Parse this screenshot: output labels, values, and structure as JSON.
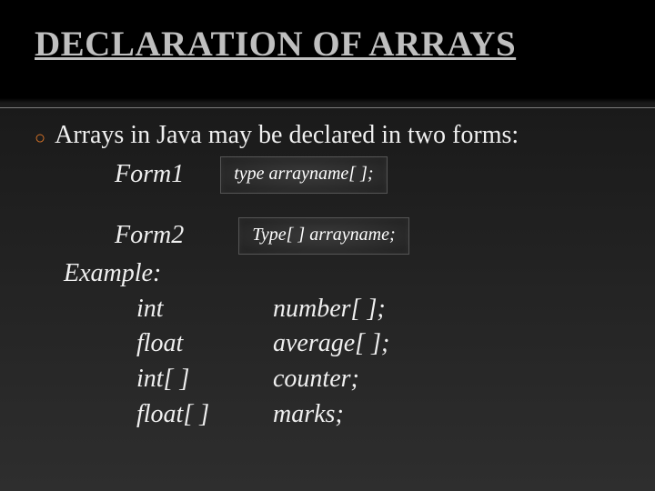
{
  "title": "DECLARATION OF ARRAYS",
  "intro": "Arrays in Java may be declared in two forms:",
  "form1": {
    "label": "Form1",
    "box": "type arrayname[ ];"
  },
  "form2": {
    "label": "Form2",
    "box": "Type[ ] arrayname;"
  },
  "exampleLabel": "Example:",
  "examples": [
    {
      "a": "int",
      "b": "number[ ];"
    },
    {
      "a": "float",
      "b": "average[ ];"
    },
    {
      "a": "int[ ]",
      "b": "counter;"
    },
    {
      "a": "float[ ]",
      "b": " marks;"
    }
  ]
}
